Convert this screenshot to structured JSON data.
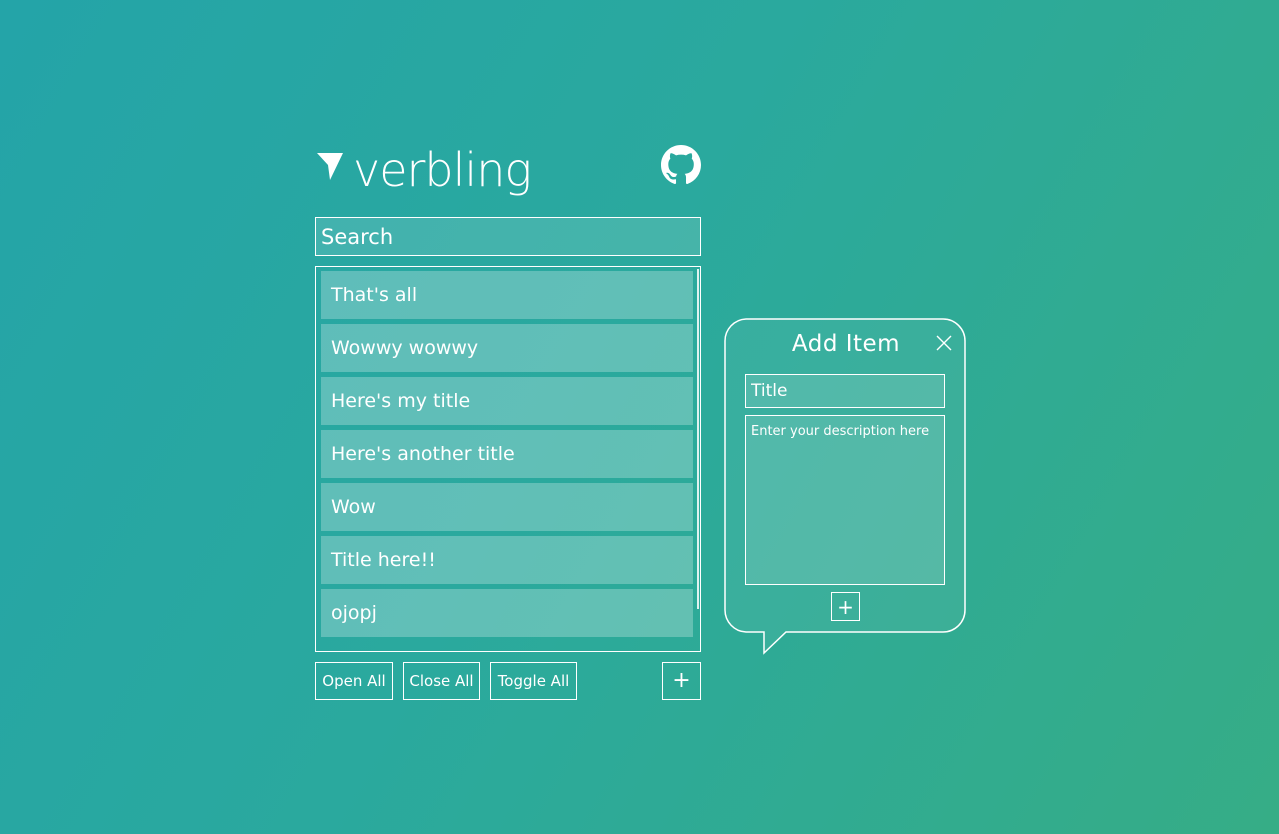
{
  "app": {
    "name": "verbling",
    "logo_icon": "arrow-cursor-icon",
    "github_icon": "github-icon"
  },
  "search": {
    "placeholder": "Search"
  },
  "list": {
    "items": [
      {
        "title": "That's all"
      },
      {
        "title": "Wowwy wowwy"
      },
      {
        "title": "Here's my title"
      },
      {
        "title": "Here's another title"
      },
      {
        "title": "Wow"
      },
      {
        "title": "Title here!!"
      },
      {
        "title": "ojopj"
      }
    ]
  },
  "controls": {
    "open_all": "Open All",
    "close_all": "Close All",
    "toggle_all": "Toggle All",
    "add": "+"
  },
  "add_item_popup": {
    "heading": "Add Item",
    "close_icon": "close-icon",
    "title_placeholder": "Title",
    "description_placeholder": "Enter your description here",
    "submit": "+"
  },
  "colors": {
    "background_start": "#24a4a8",
    "background_end": "#36ad86",
    "foreground": "#ffffff"
  }
}
